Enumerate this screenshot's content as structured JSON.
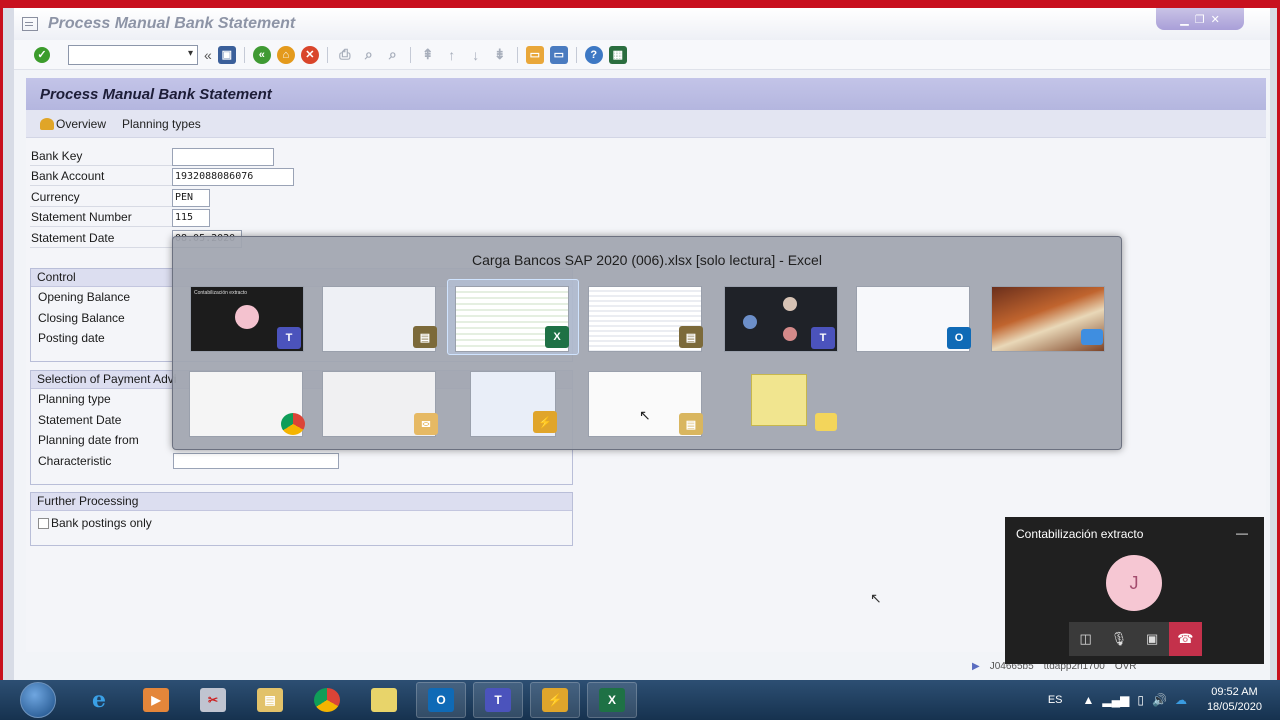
{
  "window": {
    "title": "Process Manual Bank Statement"
  },
  "screen": {
    "title": "Process Manual Bank Statement",
    "toolbar": {
      "overview": "Overview",
      "planning_types": "Planning types"
    }
  },
  "fields": {
    "bank_key": {
      "label": "Bank Key",
      "value": ""
    },
    "bank_account": {
      "label": "Bank Account",
      "value": "1932088086076"
    },
    "currency": {
      "label": "Currency",
      "value": "PEN"
    },
    "statement_number": {
      "label": "Statement Number",
      "value": "115"
    },
    "statement_date": {
      "label": "Statement Date",
      "value": "08.05.2020"
    }
  },
  "control": {
    "header": "Control",
    "rows": [
      "Opening Balance",
      "Closing Balance",
      "Posting date"
    ]
  },
  "selection": {
    "header": "Selection of Payment Advi",
    "rows": [
      "Planning type",
      "Statement Date",
      "Planning date from",
      "Characteristic"
    ]
  },
  "further": {
    "header": "Further Processing",
    "bank_postings_only": "Bank postings only"
  },
  "statusbar": {
    "client": "J04665b5",
    "server": "ttdapp2ri1700",
    "mode": "OVR"
  },
  "switcher": {
    "title": "Carga Bancos SAP 2020 (006).xlsx  [solo lectura] - Excel",
    "teams_thumb_title": "Contabilización extracto"
  },
  "teams": {
    "title": "Contabilización extracto",
    "avatar_initial": "J",
    "minimize": "—"
  },
  "taskbar": {
    "lang": "ES",
    "time": "09:52 AM",
    "date": "18/05/2020"
  },
  "colors": {
    "frame": "#c8101e",
    "title_band": "#b4b6df",
    "teams_end": "#c4314b",
    "excel": "#1e7145",
    "teams": "#4b53bc"
  },
  "icons": [
    "ok-icon",
    "save-icon",
    "back-icon",
    "exit-icon",
    "cancel-icon",
    "print-icon",
    "find-icon",
    "help-icon",
    "overview-icon",
    "ie-icon",
    "chrome-icon",
    "outlook-icon",
    "teams-icon",
    "excel-icon",
    "sap-icon"
  ]
}
